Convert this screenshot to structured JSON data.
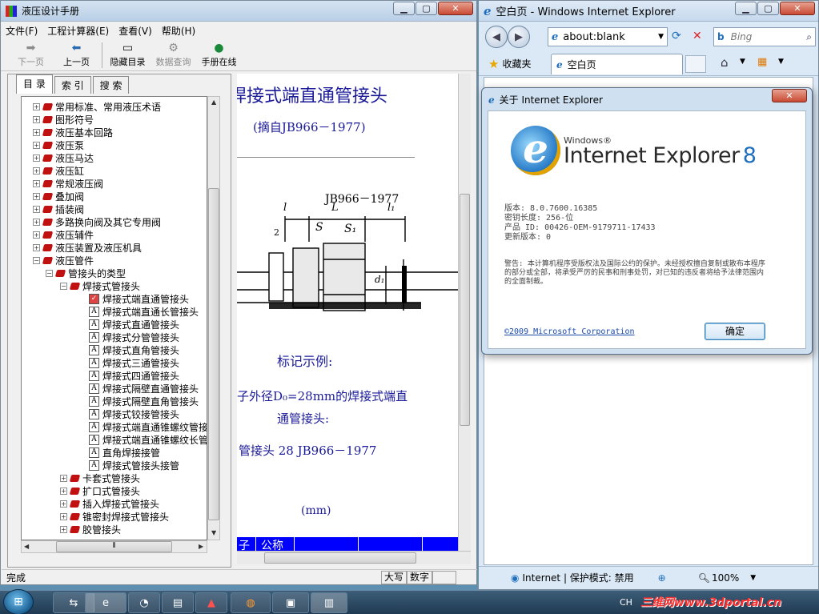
{
  "app": {
    "title": "液压设计手册",
    "menu": [
      "文件(F)",
      "工程计算器(E)",
      "查看(V)",
      "帮助(H)"
    ],
    "toolbar": [
      {
        "label": "下一页",
        "icon": "right-arrow-icon",
        "disabled": true
      },
      {
        "label": "上一页",
        "icon": "left-arrow-icon",
        "disabled": false
      },
      {
        "label": "隐藏目录",
        "icon": "hide-toc-icon",
        "disabled": false
      },
      {
        "label": "数据查询",
        "icon": "data-query-icon",
        "disabled": true
      },
      {
        "label": "手册在线",
        "icon": "globe-icon",
        "disabled": false
      }
    ],
    "nav_tabs": [
      "目 录",
      "索 引",
      "搜 索"
    ],
    "tree": [
      {
        "label": "常用标准、常用液压术语",
        "level": 0,
        "type": "book"
      },
      {
        "label": "图形符号",
        "level": 0,
        "type": "book"
      },
      {
        "label": "液压基本回路",
        "level": 0,
        "type": "book"
      },
      {
        "label": "液压泵",
        "level": 0,
        "type": "book"
      },
      {
        "label": "液压马达",
        "level": 0,
        "type": "book"
      },
      {
        "label": "液压缸",
        "level": 0,
        "type": "book"
      },
      {
        "label": "常规液压阀",
        "level": 0,
        "type": "book"
      },
      {
        "label": "叠加阀",
        "level": 0,
        "type": "book"
      },
      {
        "label": "插装阀",
        "level": 0,
        "type": "book"
      },
      {
        "label": "多路换向阀及其它专用阀",
        "level": 0,
        "type": "book"
      },
      {
        "label": "液压辅件",
        "level": 0,
        "type": "book"
      },
      {
        "label": "液压装置及液压机具",
        "level": 0,
        "type": "book"
      },
      {
        "label": "液压管件",
        "level": 0,
        "type": "book",
        "expanded": true
      },
      {
        "label": "管接头的类型",
        "level": 1,
        "type": "book",
        "expanded": true
      },
      {
        "label": "焊接式管接头",
        "level": 2,
        "type": "book",
        "expanded": true
      },
      {
        "label": "焊接式端直通管接头",
        "level": 3,
        "type": "doc",
        "selected": true
      },
      {
        "label": "焊接式端直通长管接头",
        "level": 3,
        "type": "doc"
      },
      {
        "label": "焊接式直通管接头",
        "level": 3,
        "type": "doc"
      },
      {
        "label": "焊接式分管管接头",
        "level": 3,
        "type": "doc"
      },
      {
        "label": "焊接式直角管接头",
        "level": 3,
        "type": "doc"
      },
      {
        "label": "焊接式三通管接头",
        "level": 3,
        "type": "doc"
      },
      {
        "label": "焊接式四通管接头",
        "level": 3,
        "type": "doc"
      },
      {
        "label": "焊接式隔壁直通管接头",
        "level": 3,
        "type": "doc"
      },
      {
        "label": "焊接式隔壁直角管接头",
        "level": 3,
        "type": "doc"
      },
      {
        "label": "焊接式铰接管接头",
        "level": 3,
        "type": "doc"
      },
      {
        "label": "焊接式端直通锥螺纹管接头",
        "level": 3,
        "type": "doc"
      },
      {
        "label": "焊接式端直通锥螺纹长管接头",
        "level": 3,
        "type": "doc"
      },
      {
        "label": "直角焊接接管",
        "level": 3,
        "type": "doc"
      },
      {
        "label": "焊接式管接头接管",
        "level": 3,
        "type": "doc"
      },
      {
        "label": "卡套式管接头",
        "level": 2,
        "type": "book"
      },
      {
        "label": "扩口式管接头",
        "level": 2,
        "type": "book"
      },
      {
        "label": "插入焊接式管接头",
        "level": 2,
        "type": "book"
      },
      {
        "label": "锥密封焊接式管接头",
        "level": 2,
        "type": "book"
      },
      {
        "label": "胶管接头",
        "level": 2,
        "type": "book"
      }
    ],
    "content": {
      "heading": "焊接式端直通管接头",
      "source": "(摘自JB966－1977)",
      "drawing_std": "JB966－1977",
      "dim_l": "l",
      "dim_L": "L",
      "dim_l1": "l₁",
      "dim_2": "2",
      "dim_S": "S",
      "dim_S1": "S₁",
      "dim_d": "d₁",
      "example_title": "标记示例:",
      "example_line1": "子外径D₀=28mm的焊接式端直",
      "example_line2": "通管接头:",
      "example_code": "管接头 28 JB966－1977",
      "unit": "(mm)",
      "table_head": [
        "子",
        "公称"
      ]
    },
    "status": "完成",
    "status_boxes": [
      "大写",
      "数字"
    ]
  },
  "ie": {
    "title": "空白页 - Windows Internet Explorer",
    "address": "about:blank",
    "search_placeholder": "Bing",
    "favorites_label": "收藏夹",
    "tab_label": "空白页",
    "status_zone": "Internet | 保护模式: 禁用",
    "zoom": "100%"
  },
  "dialog": {
    "title": "关于 Internet Explorer",
    "brand_small": "Windows®",
    "brand_large": "Internet Explorer",
    "brand_version": "8",
    "version": "版本: 8.0.7600.16385",
    "cipher": "密钥长度: 256-位",
    "product_id": "产品 ID: 00426-OEM-9179711-17433",
    "update": "更新版本: 0",
    "warning": "警告: 本计算机程序受版权法及国际公约的保护。未经授权擅自复制或散布本程序的部分或全部，将承受严厉的民事和刑事处罚，对已知的违反者将给予法律范围内的全面制裁。",
    "copyright": "©2009 Microsoft Corporation",
    "ok": "确定"
  },
  "taskbar": {
    "lang": "CH",
    "watermark": "三维网www.3dportal.cn"
  },
  "colors": {
    "content_text": "#1a1a99",
    "table_header": "#0000ff",
    "tree_book": "#c01010",
    "ie_brand": "#1f6fbf"
  }
}
